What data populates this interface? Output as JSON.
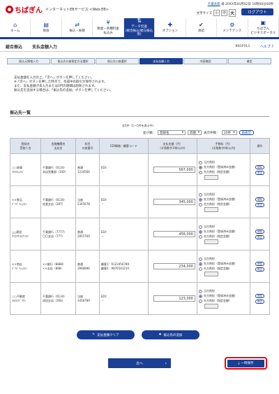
{
  "header": {
    "logo_text": "ちばぎん",
    "service_name": "インターネットEBサービス <Web-EB>",
    "user_name": "千葉太郎",
    "user_suffix": "様",
    "last_login": "20XX年04月02日 10時00分00秒",
    "textsize_label": "文字サイズ",
    "size_small": "小",
    "size_medium": "中",
    "size_large": "大",
    "logout_label": "ログアウト"
  },
  "nav": [
    {
      "label": "ホーム",
      "icon": "home-icon",
      "glyph": "⌂"
    },
    {
      "label": "照会",
      "icon": "inquiry-icon",
      "glyph": "▤"
    },
    {
      "label": "振込・振替",
      "icon": "transfer-icon",
      "glyph": "⇄"
    },
    {
      "label": "税金・各種料金\n払込み",
      "icon": "tax-icon",
      "glyph": "¥"
    },
    {
      "label": "データ伝送\n(総合振込/給与振込等)",
      "icon": "data-transmission-icon",
      "glyph": "⇅"
    },
    {
      "label": "オプション",
      "icon": "option-icon",
      "glyph": "✚"
    },
    {
      "label": "承認",
      "icon": "approval-icon",
      "glyph": "✔"
    },
    {
      "label": "メンテナンス",
      "icon": "maintenance-icon",
      "glyph": "⚙"
    },
    {
      "label": "ちばぎん\nビジネスポータル",
      "icon": "portal-icon",
      "glyph": "▣"
    }
  ],
  "page": {
    "title_main": "総合振込",
    "title_sub": "支払金額入力",
    "screen_id": "BSGF013",
    "help_label": "ヘルプ ?"
  },
  "steps": [
    "振込元情報入力",
    "振込先口座指定方法選択",
    "振込先口座選択",
    "支払金額入力",
    "内容確認",
    "確定"
  ],
  "notes": [
    "支払金額を入力の上、「次へ」ボタンを押してください。",
    "※「次へ」ボタンを押した時点で、作成中の取引が保存されます。",
    "また、支払金額が未入力または0円の明細は削除されます。",
    "振込先を追加する場合は、「振込先の追加」ボタンを押してください。"
  ],
  "list": {
    "section_title": "振込先一覧",
    "count_text": "全5件（1～5件を表示中）",
    "sort_label": "並び順：",
    "sort_value": "登録名",
    "order_value": "昇順",
    "display_label": "表示件数：",
    "display_value": "10件",
    "redisplay_label": "再表示",
    "columns": {
      "name": "登録名\n受取人名",
      "bank": "金融機関名\n支店名",
      "account": "科目\n口座番号",
      "edi": "EDI情報／顧客コード",
      "amount": "支払金額（円）\n(半角数字10桁以内)",
      "fee": "手数料（円）\n(半角数字4桁以内)",
      "op": "操作"
    },
    "rows": [
      {
        "name": "○○商事",
        "kana": "ﾏﾙﾏﾙｼｮｳｼﾞ",
        "bank": "千葉銀行（0134）",
        "branch": "本店営業部（100）",
        "type": "普通",
        "acct": "1234566",
        "edi1": "EDI：",
        "edi2": "－",
        "amount": "567,000",
        "fee_sel": 1
      },
      {
        "name": "××食品",
        "kana": "ﾊﾞﾂﾊﾞﾂｼｮｸﾋﾝ",
        "bank": "千葉銀行（0134）",
        "branch": "佐倉支店（287）",
        "type": "当座",
        "acct": "2345678",
        "edi1": "EDI：",
        "edi2": "－",
        "amount": "345,000",
        "fee_sel": 1
      },
      {
        "name": "△△建設",
        "kana": "ｻﾝｶｸｻﾝｶｸｹﾝｾﾂ",
        "bank": "千葉銀行（7777）",
        "branch": "〇〇支店（777）",
        "type": "普通",
        "acct": "2855769",
        "edi1": "EDI：",
        "edi2": "－",
        "amount": "456,000",
        "fee_sel": 1
      },
      {
        "name": "××商店",
        "kana": "ﾊﾞﾂﾊﾞﾂｼｮｳﾃﾝ",
        "bank": "××銀行（8888）",
        "branch": "××支店（888）",
        "type": "普通",
        "acct": "3966896",
        "edi1": "顧客1：0123456789",
        "edi2": "顧客2：9876543210",
        "amount": "234,000",
        "fee_sel": 1
      },
      {
        "name": "○○不動産",
        "kana": "ﾏﾙﾏﾙﾌﾄﾞｳｻﾝ",
        "bank": "千葉銀行（0134）",
        "branch": "成田支店（266）",
        "type": "当座",
        "acct": "3456789",
        "edi1": "EDI：",
        "edi2": "－",
        "amount": "123,000",
        "fee_sel": 1
      }
    ],
    "fee_options": [
      "当方負担",
      "先方負担（登録済み金額）",
      "先方負担（指定金額）"
    ],
    "delete_label": "削除",
    "edit_label": "修正"
  },
  "buttons": {
    "clear": "支払金額クリア",
    "add": "振込先の追加",
    "next": "次へ",
    "save": "一時保存"
  }
}
